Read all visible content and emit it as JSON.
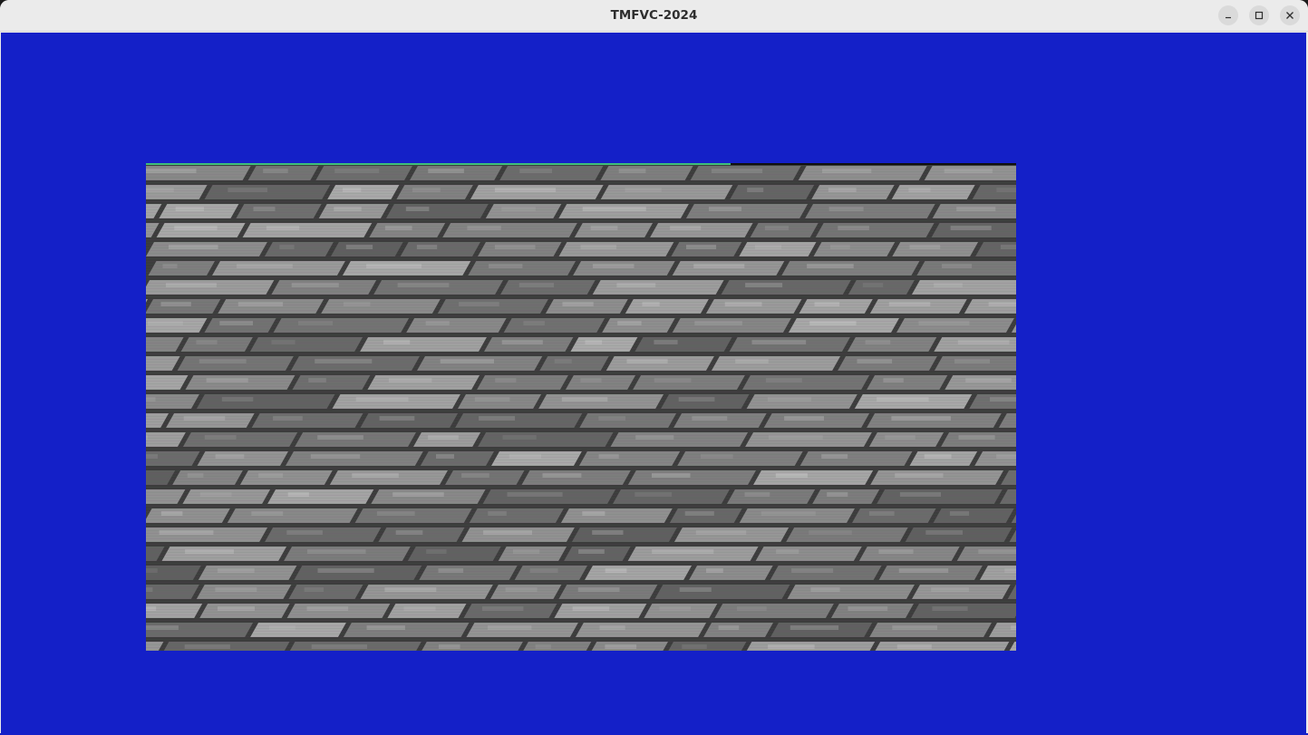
{
  "window": {
    "title": "TMFVC-2024",
    "controls": {
      "minimize_icon": "minimize-icon",
      "maximize_icon": "maximize-icon",
      "close_icon": "close-icon"
    }
  },
  "viewport": {
    "background_color": "#1420c8",
    "content": "stone-brick-texture"
  }
}
